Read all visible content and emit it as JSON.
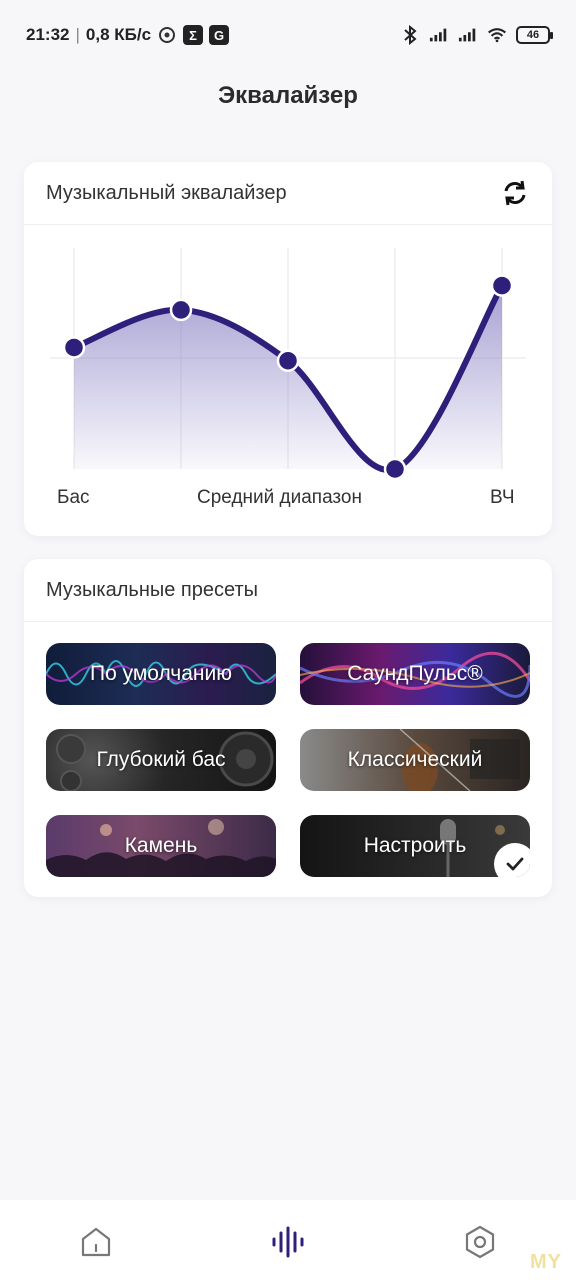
{
  "status": {
    "time": "21:32",
    "speed": "0,8 КБ/с",
    "battery": "46"
  },
  "page": {
    "title": "Эквалайзер"
  },
  "equalizer": {
    "header": "Музыкальный эквалайзер",
    "labels": {
      "bass": "Бас",
      "mid": "Средний диапазон",
      "treble": "ВЧ"
    },
    "levels": [
      0.55,
      0.72,
      0.49,
      0.0,
      0.83
    ],
    "accent_color": "#2d1f7a"
  },
  "presets": {
    "header": "Музыкальные пресеты",
    "items": [
      {
        "label": "По умолчанию"
      },
      {
        "label": "СаундПульс®"
      },
      {
        "label": "Глубокий бас"
      },
      {
        "label": "Классический"
      },
      {
        "label": "Камень"
      },
      {
        "label": "Настроить"
      }
    ],
    "selected_index": 5
  },
  "watermark": "MY"
}
